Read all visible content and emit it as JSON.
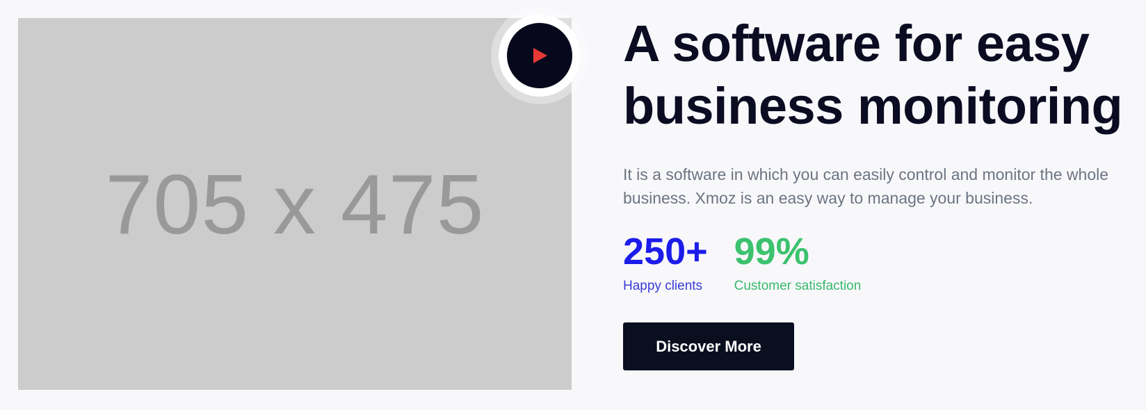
{
  "media": {
    "placeholder_text": "705 x 475",
    "play_icon": "play-icon"
  },
  "hero": {
    "title_line1": "A software for easy",
    "title_line2": "business monitoring",
    "description": "It is a software in which you can easily control and monitor the whole business. Xmoz is an easy way to manage your business."
  },
  "stats": {
    "clients": {
      "value": "250+",
      "label": "Happy clients"
    },
    "satisfaction": {
      "value": "99%",
      "label": "Customer satisfaction"
    }
  },
  "cta": {
    "label": "Discover More"
  },
  "colors": {
    "title": "#0b0b22",
    "accent_blue": "#1c1cea",
    "accent_green": "#3cc26e",
    "play_arrow": "#e53935",
    "button_bg": "#0a0f20"
  }
}
